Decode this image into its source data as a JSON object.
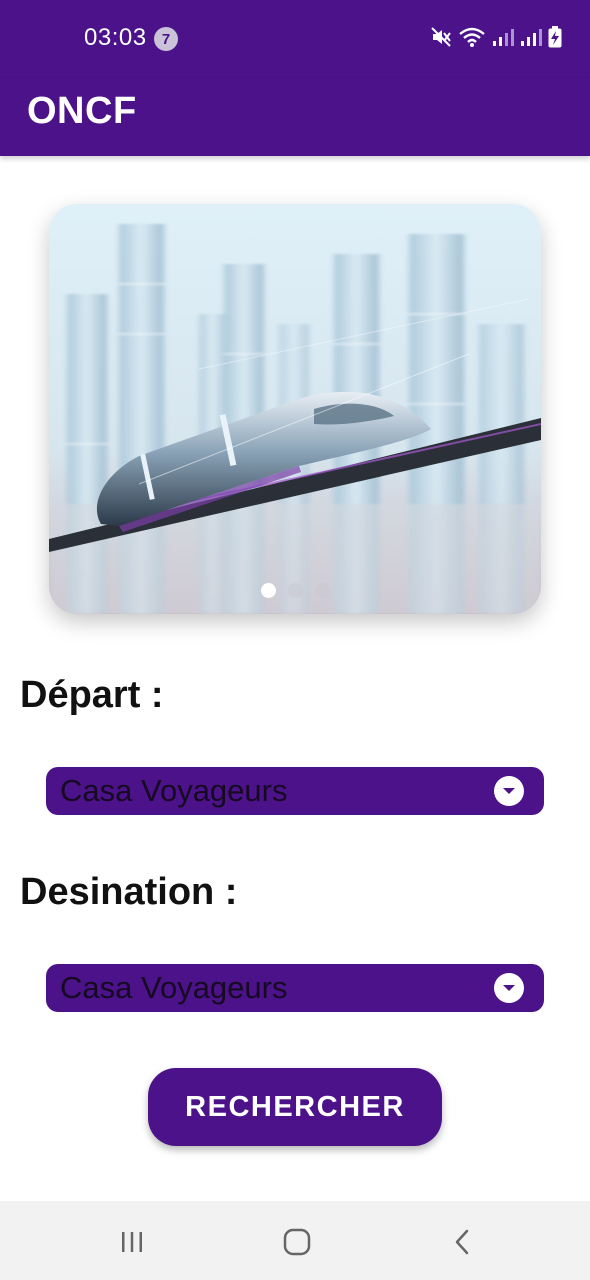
{
  "status_bar": {
    "time": "03:03",
    "notification_count": "7",
    "icons": [
      "mute-icon",
      "wifi-icon",
      "signal-icon",
      "signal-icon",
      "battery-charging-icon"
    ]
  },
  "app_bar": {
    "title": "ONCF"
  },
  "carousel": {
    "image": "hyperloop-train-city-image",
    "slide_count": 3,
    "active_slide": 1
  },
  "form": {
    "depart_label": "Départ  :",
    "depart_value": "Casa Voyageurs",
    "destination_label": "Desination :",
    "destination_value": "Casa Voyageurs",
    "search_button": "RECHERCHER"
  },
  "nav_bar": {
    "icons": [
      "recents-icon",
      "home-icon",
      "back-icon"
    ]
  },
  "colors": {
    "primary": "#4b1289",
    "nav_background": "#f2f2f2"
  }
}
